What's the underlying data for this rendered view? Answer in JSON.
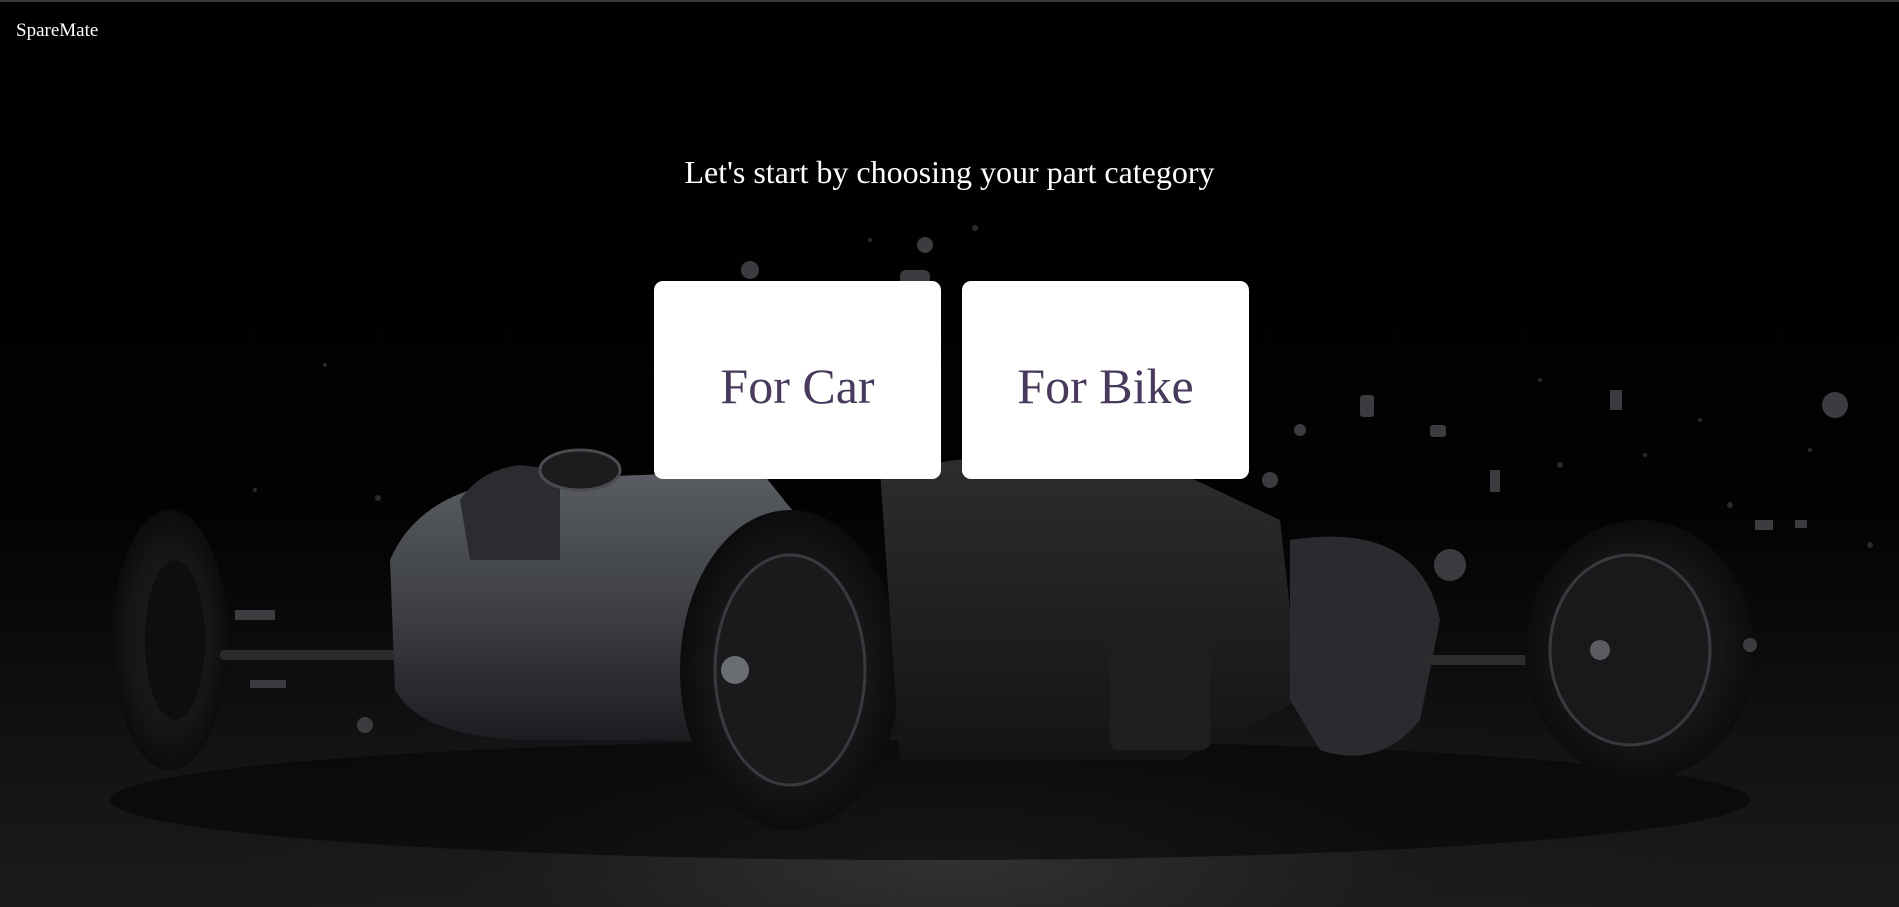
{
  "brand": {
    "name": "SpareMate"
  },
  "hero": {
    "heading": "Let's start by choosing your part category",
    "background_image": "exploded-race-car-parts-illustration"
  },
  "categories": [
    {
      "label": "For Car"
    },
    {
      "label": "For Bike"
    }
  ],
  "colors": {
    "background": "#000000",
    "card_background": "#ffffff",
    "card_text": "#483a5c",
    "heading_text": "#ffffff"
  }
}
